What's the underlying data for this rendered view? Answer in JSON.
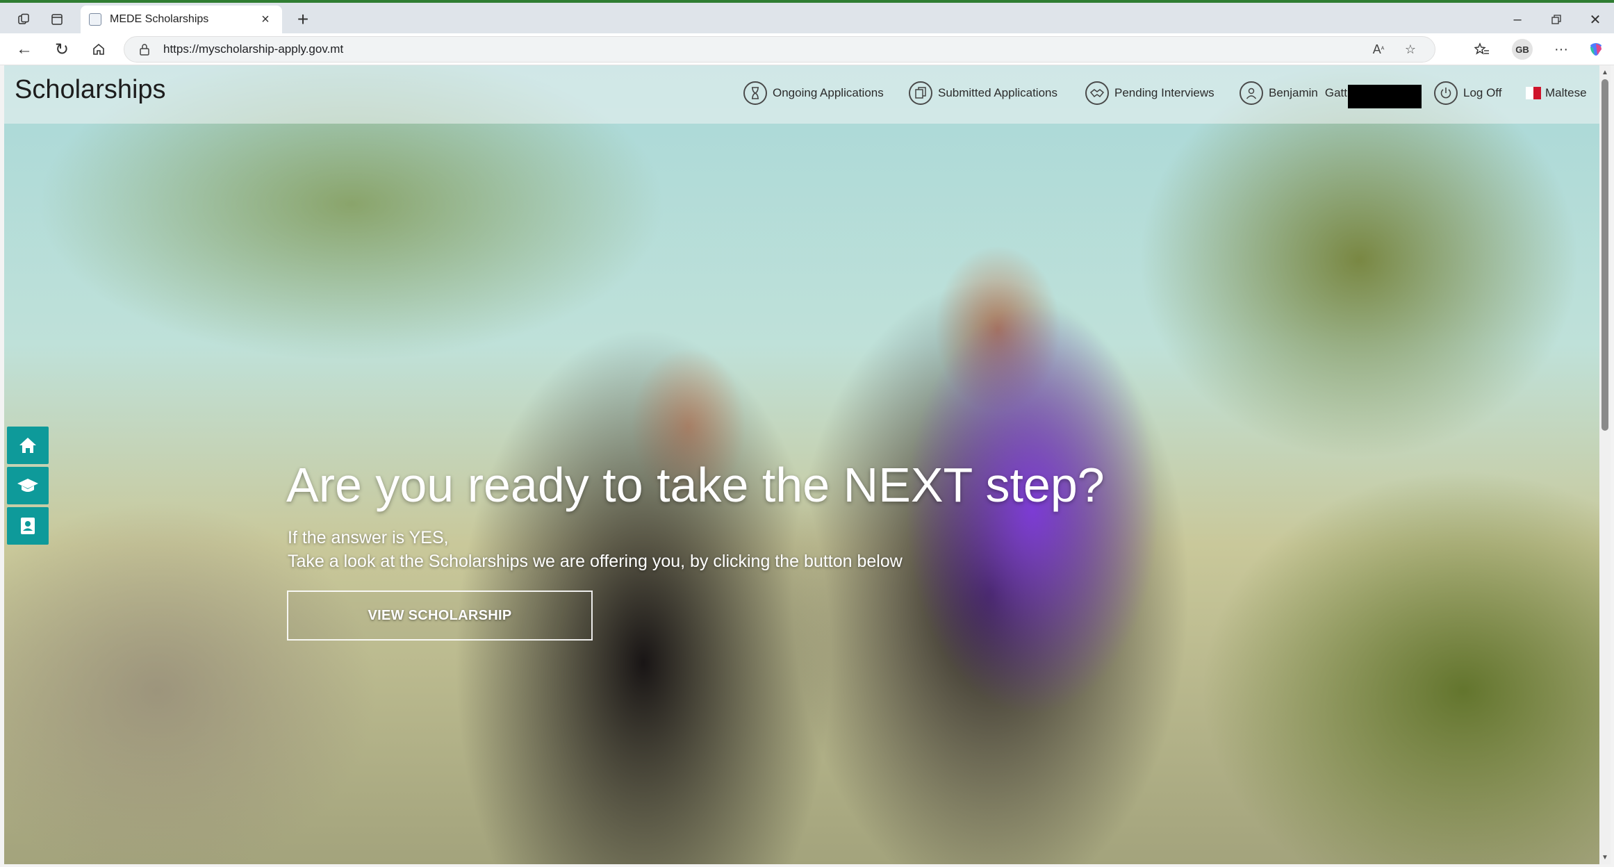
{
  "browser": {
    "tab_title": "MEDE Scholarships",
    "url": "https://myscholarship-apply.gov.mt",
    "profile_initials": "GB"
  },
  "site": {
    "brand": "Scholarships",
    "nav": {
      "ongoing": "Ongoing Applications",
      "submitted": "Submitted Applications",
      "pending": "Pending Interviews",
      "user_first": "Benjamin",
      "user_last": "Gatt",
      "logoff": "Log Off",
      "language": "Maltese"
    }
  },
  "hero": {
    "title": "Are you ready to take the NEXT step?",
    "line1": "If the answer is YES,",
    "line2": "Take a look at the Scholarships we are offering you, by clicking the button below",
    "button": "VIEW SCHOLARSHIP"
  },
  "colors": {
    "dock": "#0e9a9a",
    "accent": "#2f7d32"
  }
}
